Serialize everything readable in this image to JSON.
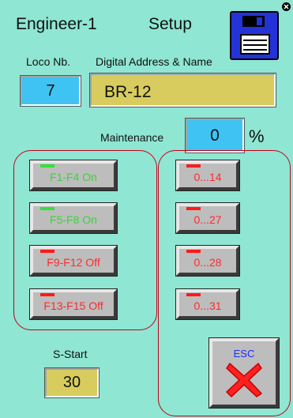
{
  "header": {
    "title": "Engineer-1",
    "setup_label": "Setup"
  },
  "loco": {
    "label": "Loco Nb.",
    "value": "7"
  },
  "address": {
    "label": "Digital Address & Name",
    "value": "BR-12"
  },
  "maintenance": {
    "label": "Maintenance",
    "value": "0",
    "unit": "%"
  },
  "function_buttons": [
    {
      "label": "F1-F4 On",
      "state": "on"
    },
    {
      "label": "F5-F8 On",
      "state": "on"
    },
    {
      "label": "F9-F12 Off",
      "state": "off"
    },
    {
      "label": "F13-F15 Off",
      "state": "off"
    }
  ],
  "range_buttons": [
    {
      "label": "0...14"
    },
    {
      "label": "0...27"
    },
    {
      "label": "0...28"
    },
    {
      "label": "0...31"
    }
  ],
  "s_start": {
    "label": "S-Start",
    "value": "30"
  },
  "esc": {
    "label": "ESC"
  },
  "colors": {
    "background": "#8fe6d2",
    "value_field_blue": "#3fc3f2",
    "name_field_yellow": "#d8cc5e",
    "group_border": "#c3001a",
    "on_color": "#33e03a",
    "off_color": "#ff1a1a"
  },
  "icons": {
    "save": "floppy-disk-icon",
    "close": "red-x-icon"
  }
}
